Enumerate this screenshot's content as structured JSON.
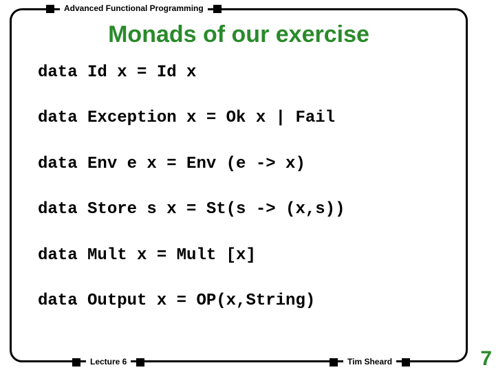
{
  "header": "Advanced Functional Programming",
  "title": "Monads of our exercise",
  "lines": [
    "data Id x = Id x",
    "data Exception x = Ok x | Fail",
    "data Env e x = Env (e -> x)",
    "data Store s x = St(s -> (x,s))",
    "data Mult x = Mult [x]",
    "data Output x = OP(x,String)"
  ],
  "footer": {
    "left": "Lecture 6",
    "right": "Tim Sheard"
  },
  "page": "7"
}
